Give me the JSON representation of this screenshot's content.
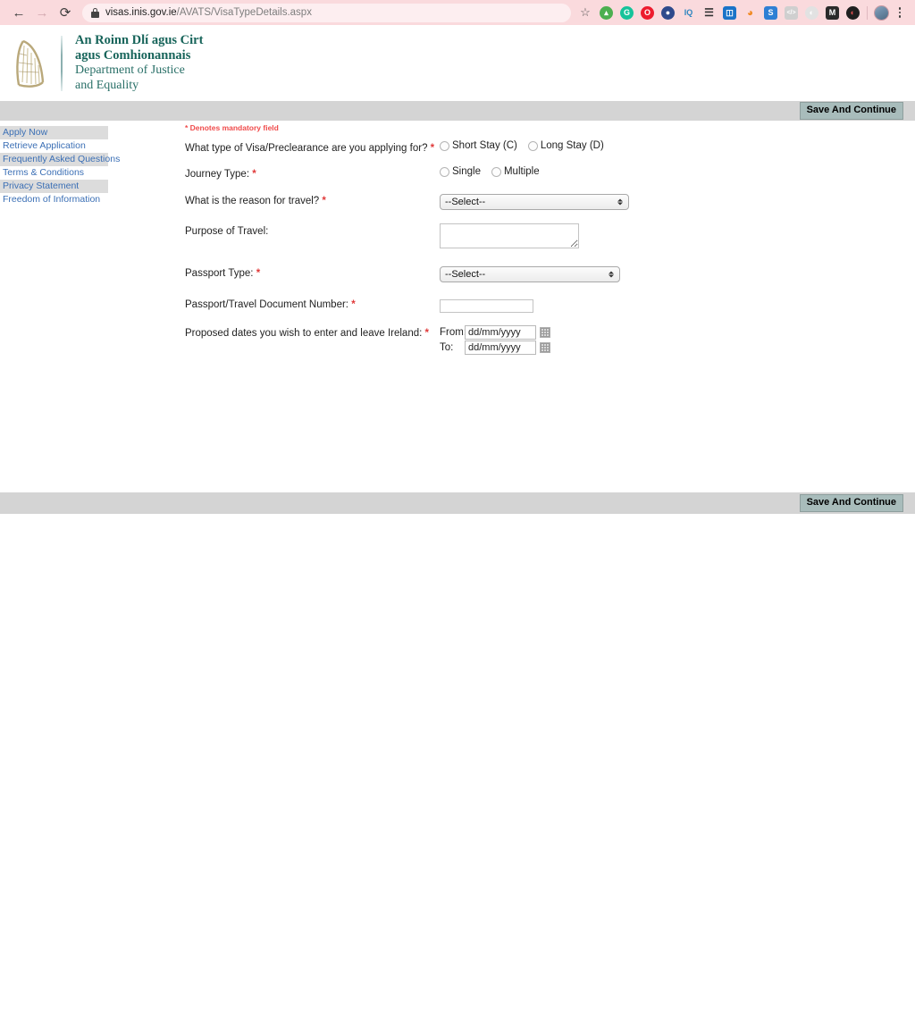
{
  "browser": {
    "back_icon": "arrow-left-icon",
    "forward_icon": "arrow-right-icon",
    "reload_icon": "reload-icon",
    "lock_icon": "lock-icon",
    "url_domain": "visas.inis.gov.ie",
    "url_path": "/AVATS/VisaTypeDetails.aspx",
    "bookmark_icon": "star-icon",
    "menu_icon": "kebab-menu-icon",
    "extensions": [
      {
        "name": "evernote-extension-icon",
        "glyph": "",
        "color": "#4caf50",
        "shape": "elephant"
      },
      {
        "name": "grammarly-extension-icon",
        "glyph": "G",
        "color": "#15c39a",
        "shape": "circle"
      },
      {
        "name": "opera-extension-icon",
        "glyph": "O",
        "color": "#ed1b2e",
        "shape": "circle"
      },
      {
        "name": "moon-reader-extension-icon",
        "glyph": "",
        "color": "#2e4a8c",
        "shape": "circle"
      },
      {
        "name": "iq-extension-icon",
        "glyph": "IQ",
        "color": "#2e86c1",
        "shape": "text"
      },
      {
        "name": "layers-extension-icon",
        "glyph": "",
        "color": "#333333",
        "shape": "stack"
      },
      {
        "name": "trello-extension-icon",
        "glyph": "",
        "color": "#1a73c8",
        "shape": "board"
      },
      {
        "name": "rss-feed-extension-icon",
        "glyph": "",
        "color": "#f08a24",
        "shape": "rss"
      },
      {
        "name": "s-extension-icon",
        "glyph": "S",
        "color": "#2e7fd4",
        "shape": "square"
      },
      {
        "name": "code-extension-icon",
        "glyph": "</>",
        "color": "#b8b8b8",
        "shape": "square"
      },
      {
        "name": "yin-yang-extension-icon",
        "glyph": "",
        "color": "#d8d8d8",
        "shape": "circle"
      },
      {
        "name": "mailtrack-extension-icon",
        "glyph": "M",
        "color": "#2a2a2a",
        "shape": "square"
      },
      {
        "name": "dark-reader-extension-icon",
        "glyph": "",
        "color": "#1f1f1f",
        "shape": "circle"
      }
    ],
    "profile_avatar": "profile-avatar-icon"
  },
  "site_header": {
    "logo_icon": "irish-harp-logo",
    "title_irish_line1": "An Roinn Dlí agus Cirt",
    "title_irish_line2": "agus Comhionannais",
    "title_english_line1": "Department of Justice",
    "title_english_line2": "and Equality"
  },
  "toolbar": {
    "save_label": "Save And Continue"
  },
  "sidebar": {
    "items": [
      {
        "label": "Apply Now",
        "highlighted": true
      },
      {
        "label": "Retrieve Application",
        "highlighted": false
      },
      {
        "label": "Frequently Asked Questions",
        "highlighted": true
      },
      {
        "label": "Terms & Conditions",
        "highlighted": false
      },
      {
        "label": "Privacy Statement",
        "highlighted": true
      },
      {
        "label": "Freedom of Information",
        "highlighted": false
      }
    ]
  },
  "form": {
    "mandatory_note": "* Denotes mandatory field",
    "visa_type": {
      "label": "What type of Visa/Preclearance are you applying for?",
      "required": true,
      "options": [
        {
          "label": "Short Stay (C)",
          "selected": false
        },
        {
          "label": "Long Stay (D)",
          "selected": false
        }
      ]
    },
    "journey_type": {
      "label": "Journey Type:",
      "required": true,
      "options": [
        {
          "label": "Single",
          "selected": false
        },
        {
          "label": "Multiple",
          "selected": false
        }
      ]
    },
    "reason_for_travel": {
      "label": "What is the reason for travel?",
      "required": true,
      "value": "--Select--"
    },
    "purpose_of_travel": {
      "label": "Purpose of Travel:",
      "required": false,
      "value": ""
    },
    "passport_type": {
      "label": "Passport Type:",
      "required": true,
      "value": "--Select--"
    },
    "passport_number": {
      "label": "Passport/Travel Document Number:",
      "required": true,
      "value": ""
    },
    "proposed_dates": {
      "label": "Proposed dates you wish to enter and leave Ireland:",
      "required": true,
      "from_label": "From:",
      "to_label": "To:",
      "from_placeholder": "dd/mm/yyyy",
      "to_placeholder": "dd/mm/yyyy",
      "from_value": "",
      "to_value": "",
      "calendar_icon": "calendar-icon"
    }
  },
  "colors": {
    "browser_chrome": "#fadadd",
    "grey_bar": "#d4d4d4",
    "save_button": "#a8bcbb",
    "link_blue": "#3b6fb5",
    "required_red": "#e03a3a",
    "dept_green": "#1e6b5e",
    "harp_gold": "#b9a87a"
  }
}
